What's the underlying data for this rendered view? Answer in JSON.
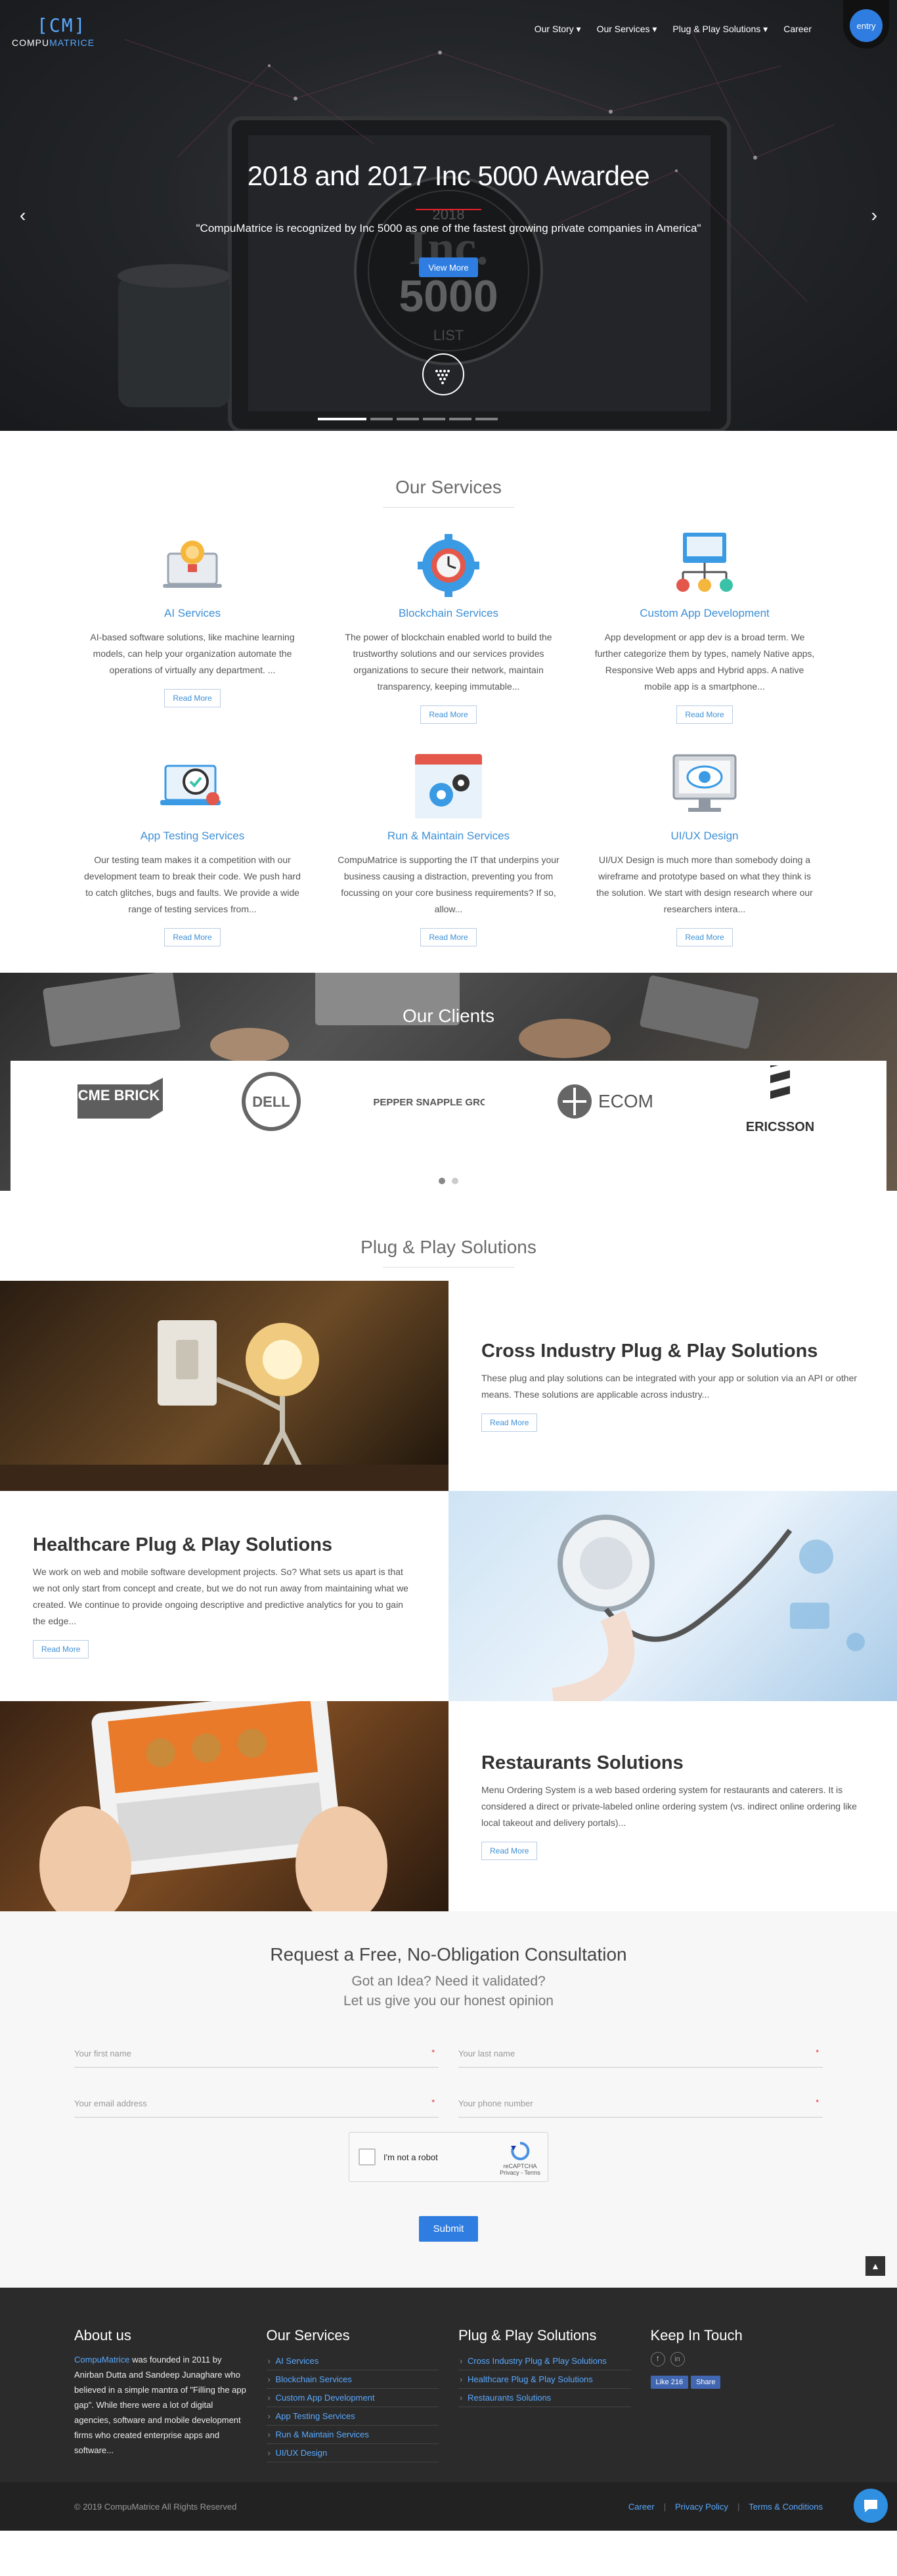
{
  "brand": {
    "logo_mark": "[CM]",
    "logo_text_a": "COMPU",
    "logo_text_b": "MATRICE"
  },
  "nav": {
    "items": [
      "Our Story",
      "Our Services",
      "Plug & Play Solutions",
      "Career"
    ],
    "entry": "entry"
  },
  "hero": {
    "title": "2018 and 2017 Inc 5000 Awardee",
    "subtitle": "\"CompuMatrice is recognized by Inc 5000 as one of the fastest growing private companies in America\"",
    "button": "View More",
    "badge_year": "2018",
    "badge_name": "Inc.",
    "badge_number": "5000",
    "badge_list": "LIST"
  },
  "services": {
    "title": "Our Services",
    "read_more": "Read More",
    "items": [
      {
        "name": "AI Services",
        "text": "AI-based software solutions, like machine learning models, can help your organization automate the operations of virtually any department. ...",
        "icon": "lightbulb-laptop-icon"
      },
      {
        "name": "Blockchain Services",
        "text": "The power of blockchain enabled world to build the trustworthy solutions and our services provides organizations to secure their network, maintain transparency, keeping immutable...",
        "icon": "gear-clock-icon"
      },
      {
        "name": "Custom App Development",
        "text": "App development or app dev is a broad term. We further categorize them by types, namely Native apps, Responsive Web apps and Hybrid apps. A native mobile app is a smartphone...",
        "icon": "monitor-hierarchy-icon"
      },
      {
        "name": "App Testing Services",
        "text": "Our testing team makes it a competition with our development team to break their code. We push hard to catch glitches, bugs and faults. We provide a wide range of testing services from...",
        "icon": "laptop-check-icon"
      },
      {
        "name": "Run & Maintain Services",
        "text": "CompuMatrice is supporting the IT that underpins your business causing a distraction, preventing you from focussing on your core business requirements? If so, allow...",
        "icon": "browser-gears-icon"
      },
      {
        "name": "UI/UX Design",
        "text": "UI/UX Design is much more than somebody doing a wireframe and prototype based on what they think is the solution. We start with design research where our researchers intera...",
        "icon": "monitor-eye-icon"
      }
    ]
  },
  "clients": {
    "title": "Our Clients",
    "logos": [
      "ACME BRICK",
      "DELL",
      "DR PEPPER SNAPPLE GROUP",
      "ECOM",
      "ERICSSON"
    ]
  },
  "plugplay": {
    "title": "Plug & Play Solutions",
    "read_more": "Read More",
    "items": [
      {
        "title": "Cross Industry Plug & Play Solutions",
        "text": "These plug and play solutions can be integrated with your app or solution via an API or other means. These solutions are applicable across industry..."
      },
      {
        "title": "Healthcare Plug & Play Solutions",
        "text": "We work on web and mobile software development projects. So? What sets us apart is that we not only start from concept and create, but we do not run away from maintaining what we created. We continue to provide ongoing descriptive and predictive analytics for you to gain the edge..."
      },
      {
        "title": "Restaurants Solutions",
        "text": "Menu Ordering System is a web based ordering system for restaurants and caterers. It is considered a direct or private-labeled online ordering system (vs. indirect online ordering like local takeout and delivery portals)..."
      }
    ]
  },
  "form": {
    "title": "Request a Free, No-Obligation Consultation",
    "tag1": "Got an Idea? Need it validated?",
    "tag2": "Let us give you our honest opinion",
    "first_name": "Your first name",
    "last_name": "Your last name",
    "email": "Your email address",
    "phone": "Your phone number",
    "required_mark": "*",
    "captcha_label": "I'm not a robot",
    "captcha_brand": "reCAPTCHA",
    "captcha_links": "Privacy - Terms",
    "submit": "Submit"
  },
  "footer": {
    "about_title": "About us",
    "about_link": "CompuMatrice",
    "about_text": " was founded in 2011 by Anirban Dutta and Sandeep Junaghare who believed in a simple mantra of \"Filling the app gap\". While there were a lot of digital agencies, software and mobile development firms who created enterprise apps and software...",
    "services_title": "Our Services",
    "services": [
      "AI Services",
      "Blockchain Services",
      "Custom App Development",
      "App Testing Services",
      "Run & Maintain Services",
      "UI/UX Design"
    ],
    "pp_title": "Plug & Play Solutions",
    "pp": [
      "Cross Industry Plug & Play Solutions",
      "Healthcare Plug & Play Solutions",
      "Restaurants Solutions"
    ],
    "touch_title": "Keep In Touch",
    "social": [
      "f",
      "in"
    ],
    "like": "Like 216",
    "share": "Share",
    "copyright": "© 2019 CompuMatrice All Rights Reserved",
    "links": [
      "Career",
      "Privacy Policy",
      "Terms & Conditions"
    ]
  },
  "colors": {
    "accent": "#2f7de1",
    "link": "#3d8fd6",
    "footer_bg": "#2b2b2b"
  }
}
